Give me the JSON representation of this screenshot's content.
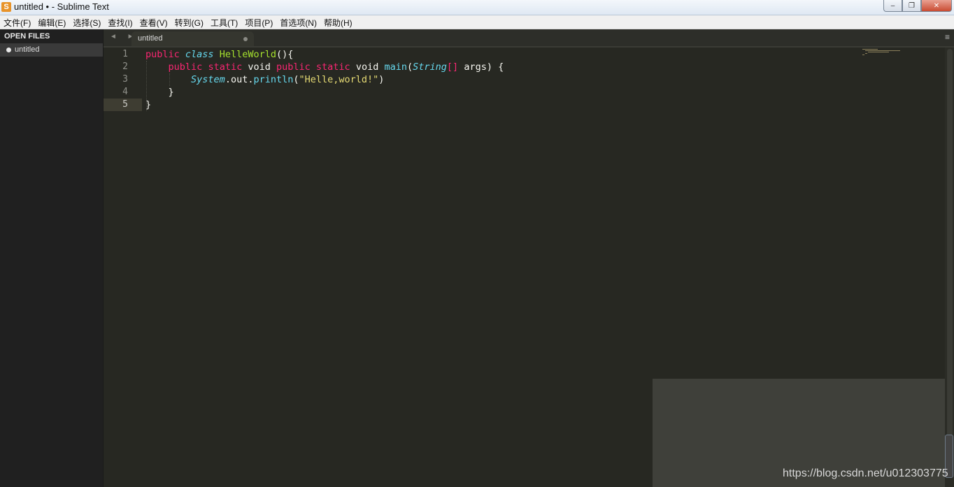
{
  "window": {
    "title": "untitled • - Sublime Text",
    "app_icon_letter": "S",
    "buttons": {
      "minimize": "–",
      "maximize": "❐",
      "close": "✕"
    }
  },
  "menu": [
    "文件(F)",
    "编辑(E)",
    "选择(S)",
    "查找(I)",
    "查看(V)",
    "转到(G)",
    "工具(T)",
    "项目(P)",
    "首选项(N)",
    "帮助(H)"
  ],
  "sidebar": {
    "header": "OPEN FILES",
    "files": [
      {
        "label": "untitled",
        "modified": true
      }
    ]
  },
  "tabs": {
    "nav_arrows": "◄ ►",
    "items": [
      {
        "label": "untitled",
        "modified": true
      }
    ],
    "menu_icon": "≡"
  },
  "editor": {
    "line_numbers": [
      "1",
      "2",
      "3",
      "4",
      "5"
    ],
    "active_line": "5",
    "code_lines": [
      [
        [
          "kw",
          "public"
        ],
        [
          "plain",
          " "
        ],
        [
          "type",
          "class"
        ],
        [
          "plain",
          " "
        ],
        [
          "cls",
          "HelleWorld"
        ],
        [
          "plain",
          "(){"
        ]
      ],
      [
        [
          "plain",
          "    "
        ],
        [
          "kw",
          "public"
        ],
        [
          "plain",
          " "
        ],
        [
          "kw",
          "static"
        ],
        [
          "plain",
          " void "
        ],
        [
          "kw",
          "public"
        ],
        [
          "plain",
          " "
        ],
        [
          "kw",
          "static"
        ],
        [
          "plain",
          " void "
        ],
        [
          "fn",
          "main"
        ],
        [
          "plain",
          "("
        ],
        [
          "type",
          "String"
        ],
        [
          "kw",
          "[]"
        ],
        [
          "plain",
          " args) {"
        ]
      ],
      [
        [
          "plain",
          "        "
        ],
        [
          "type",
          "System"
        ],
        [
          "plain",
          ".out."
        ],
        [
          "fn",
          "println"
        ],
        [
          "plain",
          "("
        ],
        [
          "str",
          "\"Helle,world!\""
        ],
        [
          "plain",
          ")"
        ]
      ],
      [
        [
          "plain",
          "    }"
        ]
      ],
      [
        [
          "plain",
          "}"
        ]
      ]
    ]
  },
  "watermark": "https://blog.csdn.net/u012303775",
  "colors": {
    "background": "#272822",
    "keyword": "#f92672",
    "type": "#66d9ef",
    "class_name": "#a6e22e",
    "string": "#e6db74",
    "text": "#f8f8f2"
  }
}
